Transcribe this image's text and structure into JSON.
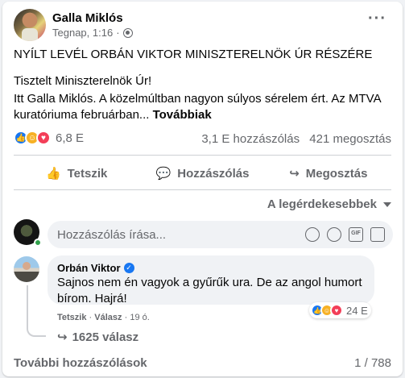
{
  "post": {
    "author": "Galla Miklós",
    "time": "Tegnap, 1:16",
    "separator": "·",
    "title": "NYÍLT LEVÉL ORBÁN VIKTOR MINISZTERELNÖK ÚR RÉSZÉRE",
    "greeting": "Tisztelt Miniszterelnök Úr!",
    "body": "Itt Galla Miklós. A közelmúltban nagyon súlyos sérelem ért. Az MTVA kuratóriuma februárban...",
    "see_more": "Továbbiak"
  },
  "stats": {
    "reactions": "6,8 E",
    "comments": "3,1 E hozzászólás",
    "shares": "421 megosztás"
  },
  "actions": {
    "like": "Tetszik",
    "comment": "Hozzászólás",
    "share": "Megosztás"
  },
  "sort_label": "A legérdekesebbek",
  "comment_input": {
    "placeholder": "Hozzászólás írása..."
  },
  "comment": {
    "author": "Orbán Viktor",
    "text": "Sajnos nem én vagyok a gyűrűk ura. De az angol humort bírom. Hajrá!",
    "reaction_count": "24 E",
    "like_label": "Tetszik",
    "dot": "·",
    "reply_label": "Válasz",
    "age": "19 ó.",
    "replies": "1625 válasz"
  },
  "footer": {
    "more_comments": "További hozzászólások",
    "pager": "1 / 788"
  },
  "colors": {
    "like_blue": "#1877f2",
    "haha_yellow": "#f7b125",
    "love_red": "#f33e58",
    "secondary_text": "#65676b"
  },
  "icons": [
    "globe-icon",
    "more-icon",
    "like-icon",
    "comment-icon",
    "share-icon",
    "emoji-icon",
    "camera-icon",
    "gif-icon",
    "sticker-icon",
    "verified-icon",
    "reply-arrow-icon"
  ]
}
